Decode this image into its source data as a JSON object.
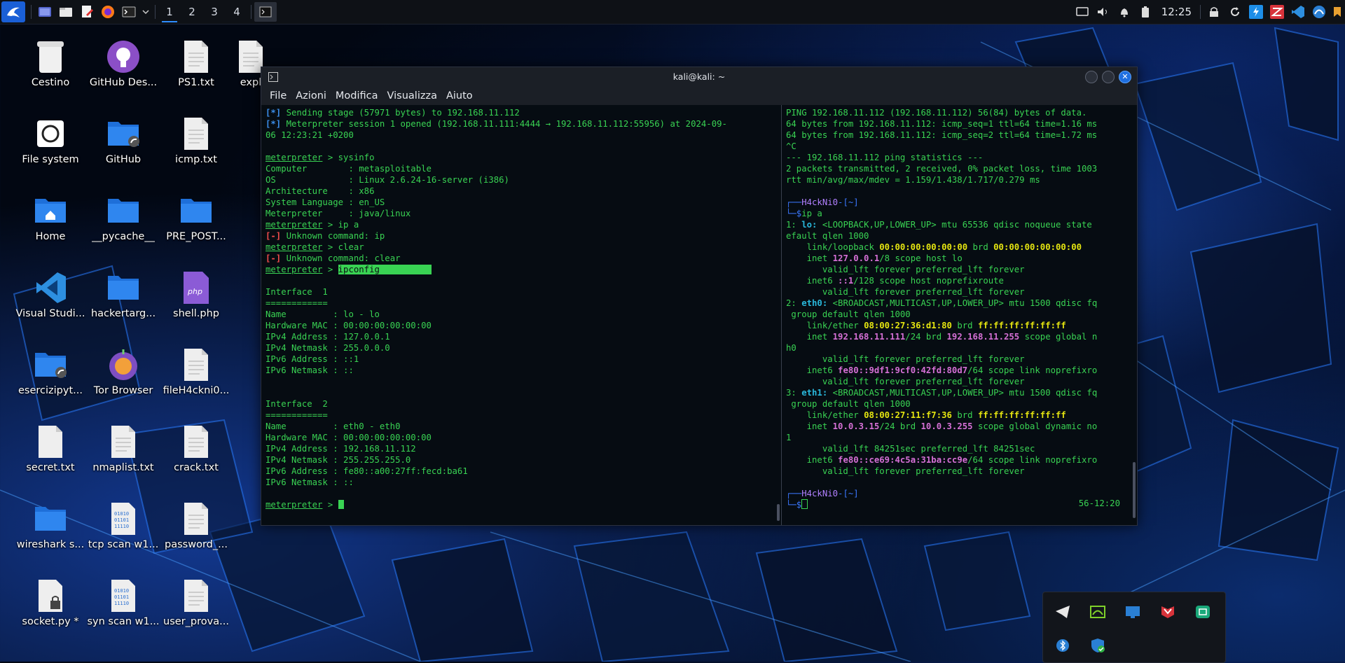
{
  "panel": {
    "workspaces": [
      "1",
      "2",
      "3",
      "4"
    ],
    "active_workspace": "1",
    "clock": "12:25",
    "launchers": [
      "kali-menu-icon",
      "workspace-icon",
      "file-manager-icon",
      "text-editor-icon",
      "firefox-icon",
      "terminal-icon"
    ],
    "tray": [
      "screen-icon",
      "volume-icon",
      "notification-bell-icon",
      "battery-icon",
      "lock-icon",
      "refresh-icon",
      "burpsuite-icon",
      "zaproxy-icon",
      "vscode-icon",
      "wireshark-icon",
      "bookmark-icon"
    ]
  },
  "desktop": {
    "icons": [
      {
        "label": "Cestino",
        "type": "trash"
      },
      {
        "label": "GitHub Des...",
        "type": "github"
      },
      {
        "label": "PS1.txt",
        "type": "text"
      },
      {
        "label": "expl",
        "type": "text"
      },
      {
        "label": "File system",
        "type": "drive"
      },
      {
        "label": "GitHub",
        "type": "folder-link"
      },
      {
        "label": "icmp.txt",
        "type": "text"
      },
      {
        "label": "Home",
        "type": "home"
      },
      {
        "label": "__pycache__",
        "type": "folder"
      },
      {
        "label": "PRE_POST...",
        "type": "folder"
      },
      {
        "label": "Visual Studi...",
        "type": "vscode"
      },
      {
        "label": "hackertarg...",
        "type": "folder"
      },
      {
        "label": "shell.php",
        "type": "php"
      },
      {
        "label": "esercizipyt...",
        "type": "folder-link"
      },
      {
        "label": "Tor Browser",
        "type": "tor"
      },
      {
        "label": "fileH4ckni0...",
        "type": "text"
      },
      {
        "label": "secret.txt",
        "type": "blank"
      },
      {
        "label": "nmaplist.txt",
        "type": "text"
      },
      {
        "label": "crack.txt",
        "type": "text"
      },
      {
        "label": "wireshark s...",
        "type": "folder"
      },
      {
        "label": "tcp scan w1...",
        "type": "binary"
      },
      {
        "label": "password_...",
        "type": "text"
      },
      {
        "label": "socket.py *",
        "type": "locked"
      },
      {
        "label": "syn scan w1...",
        "type": "binary"
      },
      {
        "label": "user_prova...",
        "type": "text"
      }
    ]
  },
  "window": {
    "title": "kali@kali: ~",
    "menu": [
      "File",
      "Azioni",
      "Modifica",
      "Visualizza",
      "Aiuto"
    ]
  },
  "left_pane": {
    "lines": [
      [
        [
          "[*]",
          "b"
        ],
        [
          " Sending stage (57971 bytes) to 192.168.11.112",
          "g"
        ]
      ],
      [
        [
          "[*]",
          "b"
        ],
        [
          " Meterpreter session 1 opened (192.168.11.111:4444 → 192.168.11.112:55956) at 2024-09-",
          "g"
        ]
      ],
      [
        [
          "06 12:23:21 +0200",
          "g"
        ]
      ],
      [
        [
          "",
          ""
        ]
      ],
      [
        [
          "meterpreter",
          "u"
        ],
        [
          " > sysinfo",
          "g"
        ]
      ],
      [
        [
          "Computer        : metasploitable",
          "g"
        ]
      ],
      [
        [
          "OS              : Linux 2.6.24-16-server (i386)",
          "g"
        ]
      ],
      [
        [
          "Architecture    : x86",
          "g"
        ]
      ],
      [
        [
          "System Language : en_US",
          "g"
        ]
      ],
      [
        [
          "Meterpreter     : java/linux",
          "g"
        ]
      ],
      [
        [
          "meterpreter",
          "u"
        ],
        [
          " > ip a",
          "g"
        ]
      ],
      [
        [
          "[-]",
          "r"
        ],
        [
          " Unknown command: ip",
          "g"
        ]
      ],
      [
        [
          "meterpreter",
          "u"
        ],
        [
          " > clear",
          "g"
        ]
      ],
      [
        [
          "[-]",
          "r"
        ],
        [
          " Unknown command: clear",
          "g"
        ]
      ],
      [
        [
          "meterpreter",
          "u"
        ],
        [
          " > ",
          "g"
        ],
        [
          "ipconfig          ",
          "sel"
        ]
      ],
      [
        [
          "",
          ""
        ]
      ],
      [
        [
          "Interface  1",
          "g"
        ]
      ],
      [
        [
          "============",
          "g"
        ]
      ],
      [
        [
          "Name         : lo - lo",
          "g"
        ]
      ],
      [
        [
          "Hardware MAC : 00:00:00:00:00:00",
          "g"
        ]
      ],
      [
        [
          "IPv4 Address : 127.0.0.1",
          "g"
        ]
      ],
      [
        [
          "IPv4 Netmask : 255.0.0.0",
          "g"
        ]
      ],
      [
        [
          "IPv6 Address : ::1",
          "g"
        ]
      ],
      [
        [
          "IPv6 Netmask : ::",
          "g"
        ]
      ],
      [
        [
          "",
          ""
        ]
      ],
      [
        [
          "",
          ""
        ]
      ],
      [
        [
          "Interface  2",
          "g"
        ]
      ],
      [
        [
          "============",
          "g"
        ]
      ],
      [
        [
          "Name         : eth0 - eth0",
          "g"
        ]
      ],
      [
        [
          "Hardware MAC : 00:00:00:00:00:00",
          "g"
        ]
      ],
      [
        [
          "IPv4 Address : 192.168.11.112",
          "g"
        ]
      ],
      [
        [
          "IPv4 Netmask : 255.255.255.0",
          "g"
        ]
      ],
      [
        [
          "IPv6 Address : fe80::a00:27ff:fecd:ba61",
          "g"
        ]
      ],
      [
        [
          "IPv6 Netmask : ::",
          "g"
        ]
      ],
      [
        [
          "",
          ""
        ]
      ],
      [
        [
          "meterpreter",
          "u"
        ],
        [
          " > ",
          "g"
        ]
      ]
    ]
  },
  "right_pane": {
    "lines": [
      [
        [
          "PING 192.168.11.112 (192.168.11.112) 56(84) bytes of data.",
          "g"
        ]
      ],
      [
        [
          "64 bytes from 192.168.11.112: icmp_seq=1 ttl=64 time=1.16 ms",
          "g"
        ]
      ],
      [
        [
          "64 bytes from 192.168.11.112: icmp_seq=2 ttl=64 time=1.72 ms",
          "g"
        ]
      ],
      [
        [
          "^C",
          "g"
        ]
      ],
      [
        [
          "--- 192.168.11.112 ping statistics ---",
          "g"
        ]
      ],
      [
        [
          "2 packets transmitted, 2 received, 0% packet loss, time 1003",
          "g"
        ]
      ],
      [
        [
          "rtt min/avg/max/mdev = 1.159/1.438/1.717/0.279 ms",
          "g"
        ]
      ],
      [
        [
          "",
          ""
        ]
      ],
      [
        [
          "┌──",
          "pb"
        ],
        [
          "H4ckNi0",
          "pm"
        ],
        [
          "-[~]",
          "pb"
        ]
      ],
      [
        [
          "└─$",
          "pb"
        ],
        [
          "ip a",
          "g"
        ]
      ],
      [
        [
          "1: ",
          "g"
        ],
        [
          "lo:",
          "c"
        ],
        [
          " <LOOPBACK,UP,LOWER_UP> mtu 65536 qdisc noqueue state",
          "g"
        ]
      ],
      [
        [
          "efault qlen 1000",
          "g"
        ]
      ],
      [
        [
          "    link/loopback ",
          "g"
        ],
        [
          "00:00:00:00:00:00",
          "y"
        ],
        [
          " brd ",
          "g"
        ],
        [
          "00:00:00:00:00:00",
          "y"
        ]
      ],
      [
        [
          "    inet ",
          "g"
        ],
        [
          "127.0.0.1",
          "m"
        ],
        [
          "/8 scope host lo",
          "g"
        ]
      ],
      [
        [
          "       valid_lft forever preferred_lft forever",
          "g"
        ]
      ],
      [
        [
          "    inet6 ",
          "g"
        ],
        [
          "::1",
          "m"
        ],
        [
          "/128 scope host noprefixroute",
          "g"
        ]
      ],
      [
        [
          "       valid_lft forever preferred_lft forever",
          "g"
        ]
      ],
      [
        [
          "2: ",
          "g"
        ],
        [
          "eth0:",
          "c"
        ],
        [
          " <BROADCAST,MULTICAST,UP,LOWER_UP> mtu 1500 qdisc fq",
          "g"
        ]
      ],
      [
        [
          " group default qlen 1000",
          "g"
        ]
      ],
      [
        [
          "    link/ether ",
          "g"
        ],
        [
          "08:00:27:36:d1:80",
          "y"
        ],
        [
          " brd ",
          "g"
        ],
        [
          "ff:ff:ff:ff:ff:ff",
          "y"
        ]
      ],
      [
        [
          "    inet ",
          "g"
        ],
        [
          "192.168.11.111",
          "m"
        ],
        [
          "/24 brd ",
          "g"
        ],
        [
          "192.168.11.255",
          "m"
        ],
        [
          " scope global n",
          "g"
        ]
      ],
      [
        [
          "h0",
          "g"
        ]
      ],
      [
        [
          "       valid_lft forever preferred_lft forever",
          "g"
        ]
      ],
      [
        [
          "    inet6 ",
          "g"
        ],
        [
          "fe80::9df1:9cf0:42fd:80d7",
          "m"
        ],
        [
          "/64 scope link noprefixro",
          "g"
        ]
      ],
      [
        [
          "       valid_lft forever preferred_lft forever",
          "g"
        ]
      ],
      [
        [
          "3: ",
          "g"
        ],
        [
          "eth1:",
          "c"
        ],
        [
          " <BROADCAST,MULTICAST,UP,LOWER_UP> mtu 1500 qdisc fq",
          "g"
        ]
      ],
      [
        [
          " group default qlen 1000",
          "g"
        ]
      ],
      [
        [
          "    link/ether ",
          "g"
        ],
        [
          "08:00:27:11:f7:36",
          "y"
        ],
        [
          " brd ",
          "g"
        ],
        [
          "ff:ff:ff:ff:ff:ff",
          "y"
        ]
      ],
      [
        [
          "    inet ",
          "g"
        ],
        [
          "10.0.3.15",
          "m"
        ],
        [
          "/24 brd ",
          "g"
        ],
        [
          "10.0.3.255",
          "m"
        ],
        [
          " scope global dynamic no",
          "g"
        ]
      ],
      [
        [
          "1",
          "g"
        ]
      ],
      [
        [
          "       valid_lft 84251sec preferred_lft 84251sec",
          "g"
        ]
      ],
      [
        [
          "    inet6 ",
          "g"
        ],
        [
          "fe80::ce69:4c5a:31ba:cc9e",
          "m"
        ],
        [
          "/64 scope link noprefixro",
          "g"
        ]
      ],
      [
        [
          "       valid_lft forever preferred_lft forever",
          "g"
        ]
      ],
      [
        [
          "",
          ""
        ]
      ],
      [
        [
          "┌──",
          "pb"
        ],
        [
          "H4ckNi0",
          "pm"
        ],
        [
          "-[~]",
          "pb"
        ]
      ],
      [
        [
          "└─$",
          "pb"
        ]
      ]
    ],
    "right_prompt": "56-12:20"
  },
  "tray_popup": {
    "icons": [
      "telegram-icon",
      "wireshark-tray-icon",
      "display-icon",
      "mcafee-icon",
      "network-icon",
      "bluetooth-icon",
      "security-shield-icon"
    ]
  },
  "colors": {
    "terminal_green": "#39d353",
    "terminal_blue": "#3b8eea",
    "terminal_red": "#f14c4c",
    "terminal_yellow": "#e5e510",
    "terminal_magenta": "#d670d6",
    "accent": "#2f8cff"
  }
}
